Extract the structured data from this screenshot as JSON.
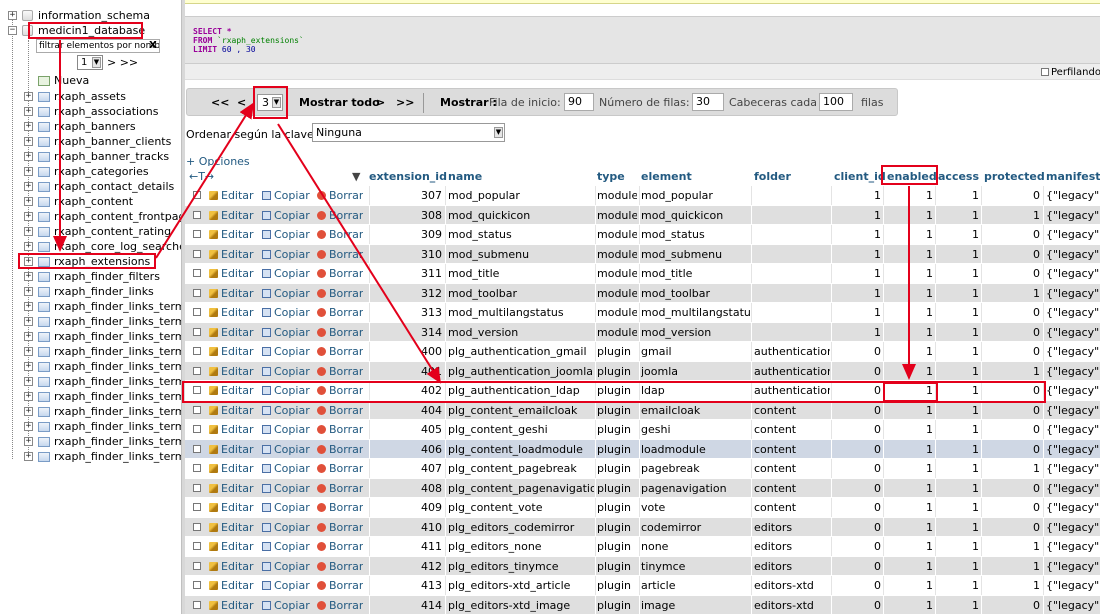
{
  "sidebar": {
    "info_schema": "information_schema",
    "database": "medicin1_database",
    "filter_placeholder": "filtrar elementos por nombr",
    "filter_clear": "X",
    "page_value": "1",
    "page_next": "> >>",
    "new_label": "Nueva",
    "tables": [
      "rxaph_assets",
      "rxaph_associations",
      "rxaph_banners",
      "rxaph_banner_clients",
      "rxaph_banner_tracks",
      "rxaph_categories",
      "rxaph_contact_details",
      "rxaph_content",
      "rxaph_content_frontpage",
      "rxaph_content_rating",
      "rxaph_core_log_searches",
      "rxaph_extensions",
      "rxaph_finder_filters",
      "rxaph_finder_links",
      "rxaph_finder_links_terms",
      "rxaph_finder_links_terms",
      "rxaph_finder_links_terms",
      "rxaph_finder_links_terms",
      "rxaph_finder_links_terms",
      "rxaph_finder_links_terms",
      "rxaph_finder_links_terms",
      "rxaph_finder_links_terms",
      "rxaph_finder_links_terms",
      "rxaph_finder_links_terms",
      "rxaph_finder_links_terms"
    ]
  },
  "sql": {
    "select": "SELECT",
    "star": " *",
    "from": "FROM",
    "table": " `rxaph_extensions`",
    "limit": "LIMIT",
    "limit_vals": " 60 , 30"
  },
  "profile_label": "Perfilando",
  "nav": {
    "first": "<<",
    "prev": "<",
    "page": "3",
    "show_all": "Mostrar todo",
    "next": ">",
    "last": ">>",
    "show_label": "Mostrar :",
    "start_row_label": "Fila de inicio:",
    "start_row": "90",
    "rows_label": "Número de filas:",
    "rows": "30",
    "headers_label": "Cabeceras cada",
    "headers": "100",
    "rows_suffix": "filas"
  },
  "order_label": "Ordenar según la clave:",
  "order_value": "Ninguna",
  "options_link": "+ Opciones",
  "table": {
    "resize_arrows": "←T→",
    "sort_marker": "▼",
    "columns": [
      "extension_id",
      "name",
      "type",
      "element",
      "folder",
      "client_id",
      "enabled",
      "access",
      "protected",
      "manifest_"
    ],
    "actions": {
      "edit": "Editar",
      "copy": "Copiar",
      "delete": "Borrar"
    },
    "rows": [
      [
        "307",
        "mod_popular",
        "module",
        "mod_popular",
        "",
        "1",
        "1",
        "1",
        "0",
        "{\"legacy\":"
      ],
      [
        "308",
        "mod_quickicon",
        "module",
        "mod_quickicon",
        "",
        "1",
        "1",
        "1",
        "1",
        "{\"legacy\":"
      ],
      [
        "309",
        "mod_status",
        "module",
        "mod_status",
        "",
        "1",
        "1",
        "1",
        "0",
        "{\"legacy\":"
      ],
      [
        "310",
        "mod_submenu",
        "module",
        "mod_submenu",
        "",
        "1",
        "1",
        "1",
        "0",
        "{\"legacy\":"
      ],
      [
        "311",
        "mod_title",
        "module",
        "mod_title",
        "",
        "1",
        "1",
        "1",
        "0",
        "{\"legacy\":"
      ],
      [
        "312",
        "mod_toolbar",
        "module",
        "mod_toolbar",
        "",
        "1",
        "1",
        "1",
        "1",
        "{\"legacy\":"
      ],
      [
        "313",
        "mod_multilangstatus",
        "module",
        "mod_multilangstatus",
        "",
        "1",
        "1",
        "1",
        "0",
        "{\"legacy\":"
      ],
      [
        "314",
        "mod_version",
        "module",
        "mod_version",
        "",
        "1",
        "1",
        "1",
        "0",
        "{\"legacy\":"
      ],
      [
        "400",
        "plg_authentication_gmail",
        "plugin",
        "gmail",
        "authentication",
        "0",
        "1",
        "1",
        "0",
        "{\"legacy\":"
      ],
      [
        "401",
        "plg_authentication_joomla",
        "plugin",
        "joomla",
        "authentication",
        "0",
        "1",
        "1",
        "1",
        "{\"legacy\":"
      ],
      [
        "402",
        "plg_authentication_ldap",
        "plugin",
        "ldap",
        "authentication",
        "0",
        "1",
        "1",
        "0",
        "{\"legacy\":"
      ],
      [
        "404",
        "plg_content_emailcloak",
        "plugin",
        "emailcloak",
        "content",
        "0",
        "1",
        "1",
        "0",
        "{\"legacy\":"
      ],
      [
        "405",
        "plg_content_geshi",
        "plugin",
        "geshi",
        "content",
        "0",
        "1",
        "1",
        "0",
        "{\"legacy\":"
      ],
      [
        "406",
        "plg_content_loadmodule",
        "plugin",
        "loadmodule",
        "content",
        "0",
        "1",
        "1",
        "0",
        "{\"legacy\":"
      ],
      [
        "407",
        "plg_content_pagebreak",
        "plugin",
        "pagebreak",
        "content",
        "0",
        "1",
        "1",
        "1",
        "{\"legacy\":"
      ],
      [
        "408",
        "plg_content_pagenavigation",
        "plugin",
        "pagenavigation",
        "content",
        "0",
        "1",
        "1",
        "0",
        "{\"legacy\":"
      ],
      [
        "409",
        "plg_content_vote",
        "plugin",
        "vote",
        "content",
        "0",
        "1",
        "1",
        "0",
        "{\"legacy\":"
      ],
      [
        "410",
        "plg_editors_codemirror",
        "plugin",
        "codemirror",
        "editors",
        "0",
        "1",
        "1",
        "0",
        "{\"legacy\":"
      ],
      [
        "411",
        "plg_editors_none",
        "plugin",
        "none",
        "editors",
        "0",
        "1",
        "1",
        "1",
        "{\"legacy\":"
      ],
      [
        "412",
        "plg_editors_tinymce",
        "plugin",
        "tinymce",
        "editors",
        "0",
        "1",
        "1",
        "1",
        "{\"legacy\":"
      ],
      [
        "413",
        "plg_editors-xtd_article",
        "plugin",
        "article",
        "editors-xtd",
        "0",
        "1",
        "1",
        "1",
        "{\"legacy\":"
      ],
      [
        "414",
        "plg_editors-xtd_image",
        "plugin",
        "image",
        "editors-xtd",
        "0",
        "1",
        "1",
        "0",
        "{\"legacy\":"
      ]
    ]
  },
  "colors": {
    "annotation": "#e3001b",
    "link": "#235a81",
    "row_alt": "#dfdfdf",
    "row_highlight": "#cfd7e4"
  }
}
